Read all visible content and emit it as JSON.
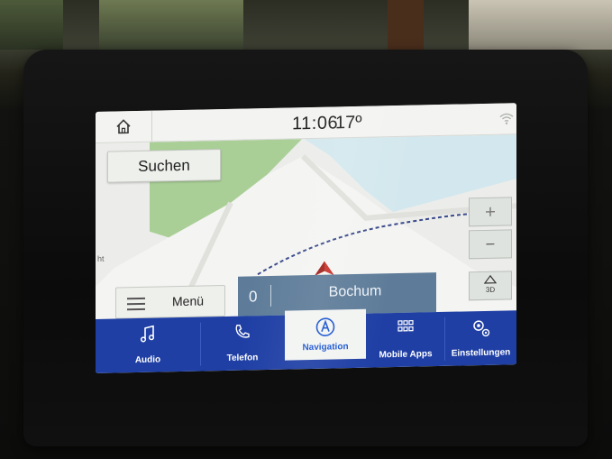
{
  "statusbar": {
    "time": "11:06",
    "temperature": "17º",
    "icons": [
      "home-icon",
      "wifi-icon"
    ]
  },
  "map": {
    "search_label": "Suchen",
    "zoom_out_label": "–",
    "view_mode_label": "3D",
    "menu_label": "Menü",
    "edge_text": "ht",
    "icons": [
      "nav-arrow-icon",
      "zoom-in-icon",
      "compass-icon"
    ]
  },
  "destination": {
    "value": "0",
    "city": "Bochum"
  },
  "bottom_nav": {
    "tabs": [
      {
        "label": "Audio",
        "icon": "music-note-icon",
        "active": false
      },
      {
        "label": "Telefon",
        "icon": "phone-icon",
        "active": false
      },
      {
        "label": "Navigation",
        "icon": "navigation-icon",
        "active": true
      },
      {
        "label": "Mobile Apps",
        "icon": "apps-grid-icon",
        "active": false
      },
      {
        "label": "Einstellungen",
        "icon": "settings-gears-icon",
        "active": false
      }
    ]
  },
  "colors": {
    "nav_bar": "#1f3fa5",
    "active_tab_text": "#1c56d0",
    "destination_panel": "#5e7c99",
    "map_green": "#a8cf95",
    "map_water": "#cfe6ec",
    "route_dashes": "#3a4a8a",
    "nav_arrow": "#c8332b"
  }
}
